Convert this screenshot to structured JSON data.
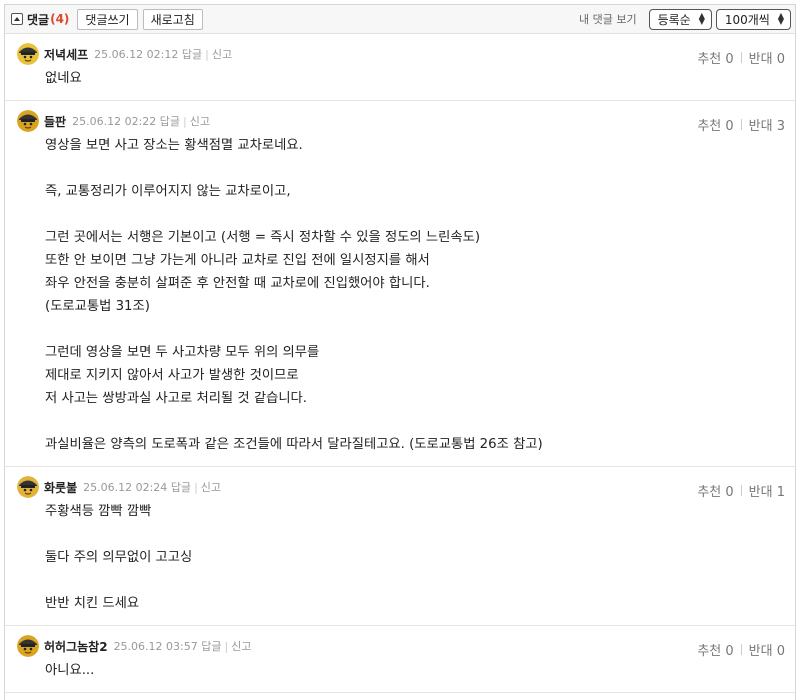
{
  "toolbar": {
    "title": "댓글",
    "count": "(4)",
    "write_label": "댓글쓰기",
    "refresh_label": "새로고침",
    "my_comments_label": "내 댓글 보기",
    "sort_value": "등록순",
    "per_page_value": "100개씩"
  },
  "labels": {
    "reply": "답글",
    "report": "신고"
  },
  "comments": [
    {
      "nick": "저녁세프",
      "date": "25.06.12 02:12",
      "up": "추천 0",
      "down": "반대 0",
      "avatar_color": "#e8c23a",
      "lines": [
        "없네요"
      ]
    },
    {
      "nick": "들판",
      "date": "25.06.12 02:22",
      "up": "추천 0",
      "down": "반대 3",
      "avatar_color": "#d9a521",
      "lines": [
        "영상을 보면 사고 장소는 황색점멸 교차로네요.",
        "",
        "즉, 교통정리가 이루어지지 않는 교차로이고,",
        "",
        "그런 곳에서는 서행은 기본이고 (서행 = 즉시 정차할 수 있을 정도의 느린속도)",
        "또한 안 보이면 그냥 가는게 아니라 교차로 진입 전에 일시정지를 해서",
        "좌우 안전을 충분히 살펴준 후 안전할 때 교차로에 진입했어야 합니다.",
        "(도로교통법 31조)",
        "",
        "그런데 영상을 보면 두 사고차량 모두 위의 의무를",
        "제대로 지키지 않아서 사고가 발생한 것이므로",
        "저 사고는 쌍방과실 사고로 처리될 것 같습니다.",
        "",
        "과실비율은 양측의 도로폭과 같은 조건들에 따라서 달라질테고요. (도로교통법 26조 참고)"
      ]
    },
    {
      "nick": "화룻불",
      "date": "25.06.12 02:24",
      "up": "추천 0",
      "down": "반대 1",
      "avatar_color": "#e0b43a",
      "lines": [
        "주황색등 깜빡 깜빡",
        "",
        "둘다 주의 의무없이 고고싱",
        "",
        "반반 치킨 드세요"
      ]
    },
    {
      "nick": "허허그놈참2",
      "date": "25.06.12 03:57",
      "up": "추천 0",
      "down": "반대 0",
      "avatar_color": "#d9a521",
      "lines": [
        "아니요..."
      ]
    }
  ]
}
